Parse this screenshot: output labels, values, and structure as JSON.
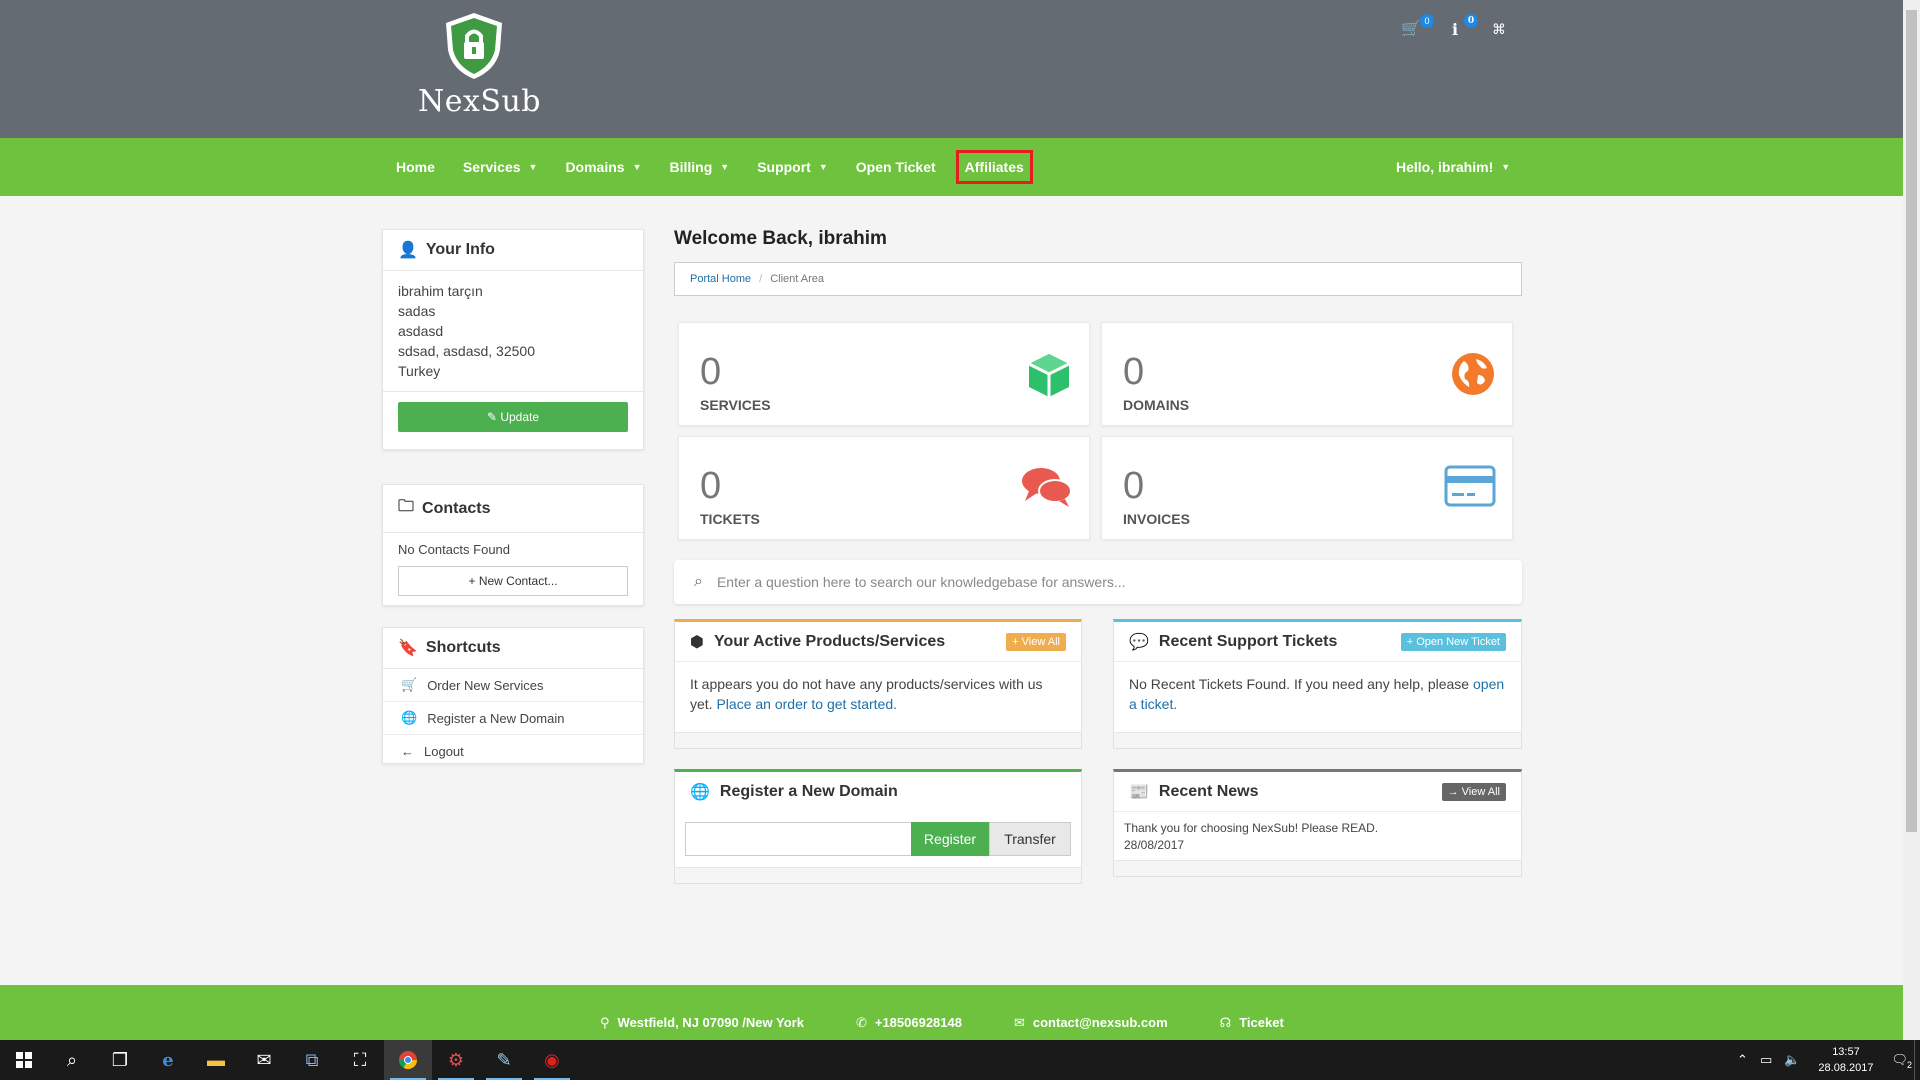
{
  "brand": {
    "name": "NexSub"
  },
  "header": {
    "cart_count": "0",
    "info_count": "0"
  },
  "nav": {
    "items": [
      {
        "label": "Home",
        "dropdown": false
      },
      {
        "label": "Services",
        "dropdown": true
      },
      {
        "label": "Domains",
        "dropdown": true
      },
      {
        "label": "Billing",
        "dropdown": true
      },
      {
        "label": "Support",
        "dropdown": true
      },
      {
        "label": "Open Ticket",
        "dropdown": false
      },
      {
        "label": "Affiliates",
        "dropdown": false
      }
    ],
    "user_label": "Hello, ibrahim!"
  },
  "sidebar": {
    "info_title": "Your Info",
    "info_lines": [
      "ibrahim tarçın",
      "sadas",
      "asdasd",
      "sdsad, asdasd, 32500",
      "Turkey"
    ],
    "update_label": "Update",
    "contacts_title": "Contacts",
    "contacts_empty": "No Contacts Found",
    "new_contact_label": "New Contact...",
    "shortcuts_title": "Shortcuts",
    "shortcuts": [
      "Order New Services",
      "Register a New Domain",
      "Logout"
    ]
  },
  "main": {
    "welcome": "Welcome Back, ibrahim",
    "breadcrumb": {
      "home": "Portal Home",
      "sep": "/",
      "current": "Client Area"
    },
    "stats": [
      {
        "value": "0",
        "label": "SERVICES",
        "color": "#2dbf6b"
      },
      {
        "value": "0",
        "label": "DOMAINS",
        "color": "#f27a2a"
      },
      {
        "value": "0",
        "label": "TICKETS",
        "color": "#e85a4f"
      },
      {
        "value": "0",
        "label": "INVOICES",
        "color": "#5aa6d6"
      }
    ],
    "kb_placeholder": "Enter a question here to search our knowledgebase for answers...",
    "products": {
      "title": "Your Active Products/Services",
      "button": "View All",
      "text": "It appears you do not have any products/services with us yet.",
      "link": "Place an order to get started."
    },
    "tickets": {
      "title": "Recent Support Tickets",
      "button": "Open New Ticket",
      "text": "No Recent Tickets Found. If you need any help, please",
      "link": "open a ticket."
    },
    "domain": {
      "title": "Register a New Domain",
      "register": "Register",
      "transfer": "Transfer"
    },
    "news": {
      "title": "Recent News",
      "button": "View All",
      "item": "Thank you for choosing NexSub! Please READ.",
      "date": "28/08/2017"
    }
  },
  "footer": {
    "address": "Westfield, NJ 07090 /New York",
    "phone": "+18506928148",
    "email": "contact@nexsub.com",
    "ticket": "Ticeket"
  },
  "taskbar": {
    "time": "13:57",
    "date": "28.08.2017",
    "notifications": "2"
  },
  "colors": {
    "header_bg": "#656b73",
    "nav_green": "#6ec23d",
    "accent_orange": "#f0ad4e",
    "accent_blue": "#5bc0de"
  }
}
